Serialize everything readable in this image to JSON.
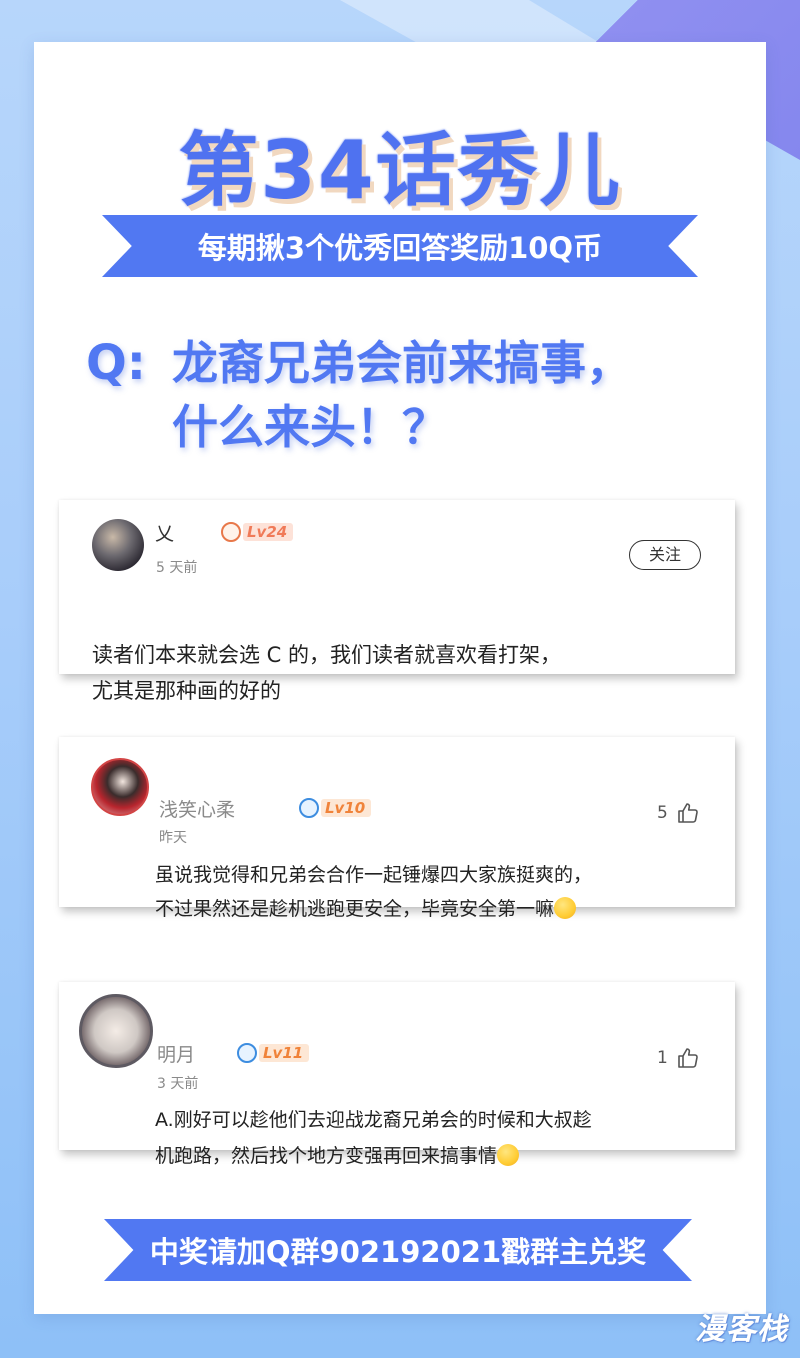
{
  "header": {
    "title": "第34话秀儿",
    "ribbon_text": "每期揪3个优秀回答奖励10Q币"
  },
  "question": {
    "prefix": "Q:",
    "line1": "龙裔兄弟会前来搞事，",
    "line2": "什么来头！？"
  },
  "comments": [
    {
      "username": "乂",
      "level": "Lv24",
      "time": "5 天前",
      "follow_label": "关注",
      "lines": [
        "读者们本来就会选 C 的，我们读者就喜欢看打架，",
        "尤其是那种画的好的"
      ]
    },
    {
      "username": "浅笑心柔",
      "level": "Lv10",
      "time": "昨天",
      "likes": "5",
      "lines": [
        "虽说我觉得和兄弟会合作一起锤爆四大家族挺爽的，",
        "不过果然还是趁机逃跑更安全，毕竟安全第一嘛"
      ],
      "emoji": "rofl-emoji"
    },
    {
      "username": "明月",
      "level": "Lv11",
      "time": "3 天前",
      "likes": "1",
      "lines": [
        "A.刚好可以趁他们去迎战龙裔兄弟会的时候和大叔趁",
        "机跑路，然后找个地方变强再回来搞事情"
      ],
      "emoji": "smirk-emoji"
    }
  ],
  "footer": {
    "ribbon_text": "中奖请加Q群902192021戳群主兑奖"
  },
  "watermark": "漫客栈",
  "colors": {
    "accent": "#5178f2",
    "background": "#a8cdfa",
    "title_shadow": "#f1d8c0",
    "level_orange": "#f07a58"
  }
}
